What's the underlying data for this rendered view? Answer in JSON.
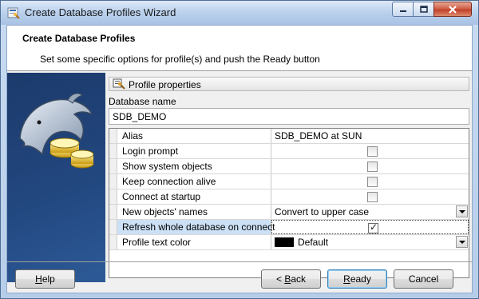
{
  "window": {
    "title": "Create Database Profiles Wizard",
    "controls": {
      "minimize": "minimize-icon",
      "maximize": "maximize-icon",
      "close": "close-icon"
    }
  },
  "header": {
    "title": "Create Database Profiles",
    "subtitle": "Set some specific options for profile(s) and push the Ready button"
  },
  "section": {
    "label": "Profile properties",
    "icon": "properties-icon"
  },
  "database": {
    "label": "Database name",
    "value": "SDB_DEMO"
  },
  "properties": [
    {
      "name": "Alias",
      "type": "text",
      "value": "SDB_DEMO at SUN"
    },
    {
      "name": "Login prompt",
      "type": "checkbox",
      "checked": false
    },
    {
      "name": "Show system objects",
      "type": "checkbox",
      "checked": false
    },
    {
      "name": "Keep connection alive",
      "type": "checkbox",
      "checked": false
    },
    {
      "name": "Connect at startup",
      "type": "checkbox",
      "checked": false
    },
    {
      "name": "New objects' names",
      "type": "select",
      "value": "Convert to upper case"
    },
    {
      "name": "Refresh whole database on connect",
      "type": "checkbox",
      "checked": true,
      "selected": true
    },
    {
      "name": "Profile text color",
      "type": "color",
      "value": "Default",
      "color": "#000000"
    }
  ],
  "buttons": {
    "help": {
      "pre": "",
      "key": "H",
      "post": "elp"
    },
    "back": {
      "pre": "< ",
      "key": "B",
      "post": "ack"
    },
    "ready": {
      "pre": "",
      "key": "R",
      "post": "eady"
    },
    "cancel": {
      "pre": "",
      "key": "",
      "post": "Cancel"
    }
  },
  "colors": {
    "selection": "#cce0f6",
    "sidepanel": "#22477f",
    "close_button": "#c2402a"
  }
}
